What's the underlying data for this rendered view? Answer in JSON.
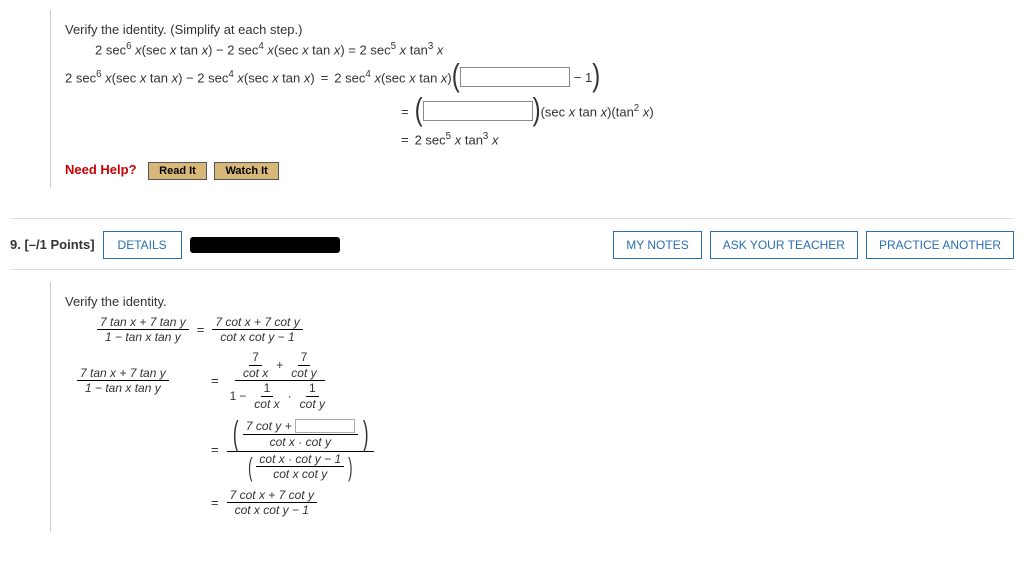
{
  "q8": {
    "prompt": "Verify the identity. (Simplify at each step.)",
    "identity_html": "2 sec<span class='sup'>6</span> <span class='ital'>x</span>(sec <span class='ital'>x</span> tan <span class='ital'>x</span>) − 2 sec<span class='sup'>4</span> <span class='ital'>x</span>(sec <span class='ital'>x</span> tan <span class='ital'>x</span>) = 2 sec<span class='sup'>5</span> <span class='ital'>x</span> tan<span class='sup'>3</span> <span class='ital'>x</span>",
    "lhs_html": "2 sec<span class='sup'>6</span> <span class='ital'>x</span>(sec <span class='ital'>x</span> tan <span class='ital'>x</span>) − 2 sec<span class='sup'>4</span> <span class='ital'>x</span>(sec <span class='ital'>x</span> tan <span class='ital'>x</span>)",
    "step1_tail_html": "− 1",
    "step1_pre_html": "2 sec<span class='sup'>4</span> <span class='ital'>x</span>(sec <span class='ital'>x</span> tan <span class='ital'>x</span>)",
    "step2_tail_html": "(sec <span class='ital'>x</span> tan <span class='ital'>x</span>)(tan<span class='sup'>2</span> <span class='ital'>x</span>)",
    "step3_html": "2 sec<span class='sup'>5</span> <span class='ital'>x</span> tan<span class='sup'>3</span> <span class='ital'>x</span>",
    "eq": "=",
    "need_help": "Need Help?",
    "read_it": "Read It",
    "watch_it": "Watch It"
  },
  "q9": {
    "num_label": "9.",
    "points": "[–/1 Points]",
    "details": "DETAILS",
    "my_notes": "MY NOTES",
    "ask_teacher": "ASK YOUR TEACHER",
    "practice": "PRACTICE ANOTHER",
    "prompt": "Verify the identity.",
    "identity_lhs_num": "7 tan x + 7 tan y",
    "identity_lhs_den": "1 − tan x tan y",
    "identity_rhs_num": "7 cot x + 7 cot y",
    "identity_rhs_den": "cot x cot y − 1",
    "step1_lhs_num": "7 tan x + 7 tan y",
    "step1_lhs_den": "1 − tan x tan y",
    "s1_inner_tl_num": "7",
    "s1_inner_tl_den": "cot x",
    "s1_inner_tr_num": "7",
    "s1_inner_tr_den": "cot y",
    "s1_inner_bl_num": "1",
    "s1_inner_bl_den": "cot x",
    "s1_inner_br_num": "1",
    "s1_inner_br_den": "cot y",
    "plus": "+",
    "dot": "·",
    "one": "1",
    "minus": "−",
    "s2_num_left": "7 cot y +",
    "s2_num_den": "cot x · cot y",
    "s2_den_num": "cot x · cot y − 1",
    "s2_den_den": "cot x cot y",
    "final_num": "7 cot x + 7 cot y",
    "final_den": "cot x cot y − 1",
    "eq": "="
  }
}
